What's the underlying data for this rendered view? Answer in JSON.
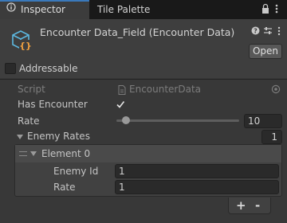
{
  "tabs": {
    "inspector": "Inspector",
    "tile_palette": "Tile Palette"
  },
  "component": {
    "title": "Encounter Data_Field (Encounter Data)",
    "open_label": "Open"
  },
  "addressable": {
    "label": "Addressable",
    "checked": false
  },
  "fields": {
    "script_label": "Script",
    "script_value": "EncounterData",
    "has_encounter_label": "Has Encounter",
    "has_encounter_checked": true,
    "rate_label": "Rate",
    "rate_value": "10",
    "rate_slider_fraction": 0.08,
    "enemy_rates_label": "Enemy Rates",
    "enemy_rates_count": "1",
    "element_label": "Element 0",
    "enemy_id_label": "Enemy Id",
    "enemy_id_value": "1",
    "element_rate_label": "Rate",
    "element_rate_value": "1"
  },
  "list_buttons": {
    "add": "+",
    "remove": "-"
  },
  "icons": {
    "tab": "inspector-info-icon",
    "lock": "lock-icon",
    "menu": "kebab-menu-icon",
    "component": "scriptable-object-icon",
    "help": "help-icon",
    "preset": "preset-sliders-icon",
    "more": "more-icon"
  }
}
